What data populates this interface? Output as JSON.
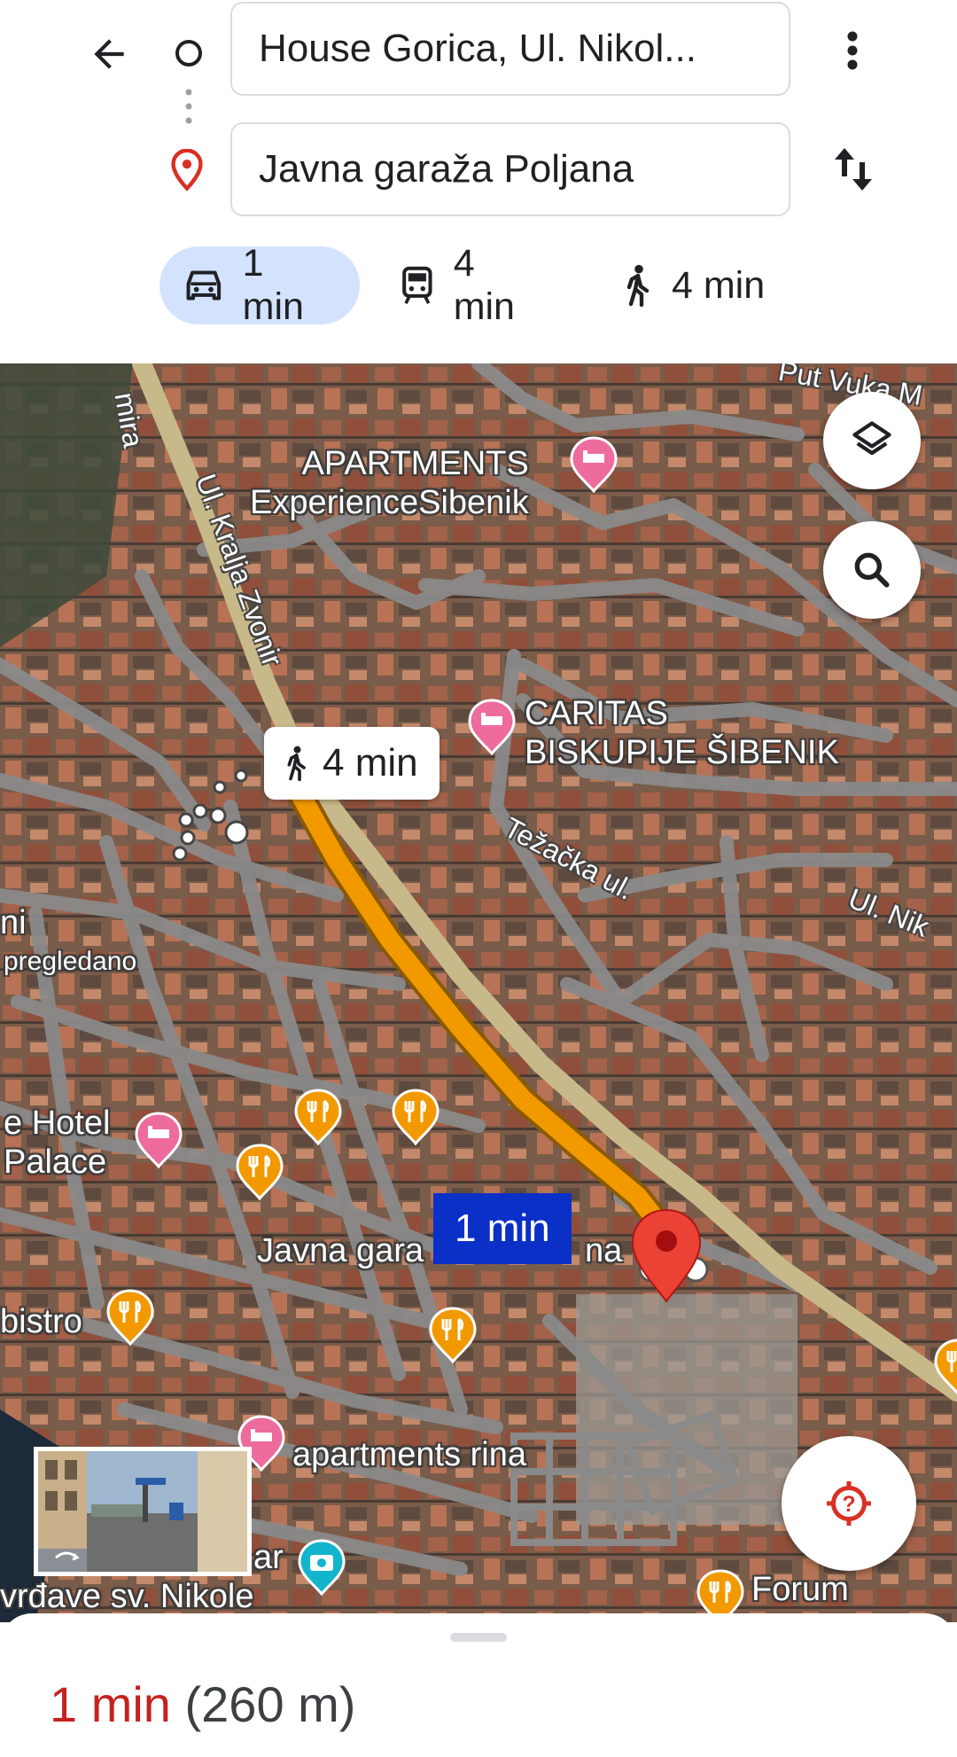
{
  "directions": {
    "origin": "House Gorica, Ul. Nikol...",
    "destination": "Javna garaža Poljana"
  },
  "travel_modes": [
    {
      "mode": "drive",
      "icon": "car-icon",
      "time": "1 min",
      "selected": true
    },
    {
      "mode": "transit",
      "icon": "train-icon",
      "time": "4 min",
      "selected": false
    },
    {
      "mode": "walk",
      "icon": "walk-icon",
      "time": "4 min",
      "selected": false
    }
  ],
  "map": {
    "labels": {
      "apartments_experience": "APARTMENTS\nExperienceSibenik",
      "caritas": "CARITAS\nBISKUPIJE ŠIBENIK",
      "hotel_palace": "e Hotel\nPalace",
      "pregledano_a": "ni",
      "pregledano_b": "pregledano",
      "bistro": "bistro",
      "apartments_rina": "apartments rina",
      "ar": "ar",
      "tvrdave": "vrđave sv. Nikole",
      "forum": "Forum",
      "garage_label_left": "Javna gara",
      "garage_label_right": "na"
    },
    "roads": {
      "kralja": "Ul. Kralja Zvonir",
      "mira": "mira",
      "tezacka": "Težačka ul.",
      "nikole": "Ul. Nik",
      "vuka": "Put Vuka M"
    },
    "walk_bubble": "4 min",
    "drive_bubble": "1 min"
  },
  "summary": {
    "time": "1 min",
    "distance": "(260 m)"
  },
  "colors": {
    "route": "#f29900",
    "selected_pill": "#d3e3fd",
    "drive_bubble": "#0b30c8",
    "destination_pin": "#ea4335",
    "summary_time": "#c5221f",
    "hotel_poi": "#ee6b9e",
    "food_poi": "#f29900",
    "camera_poi": "#12b5cb"
  }
}
